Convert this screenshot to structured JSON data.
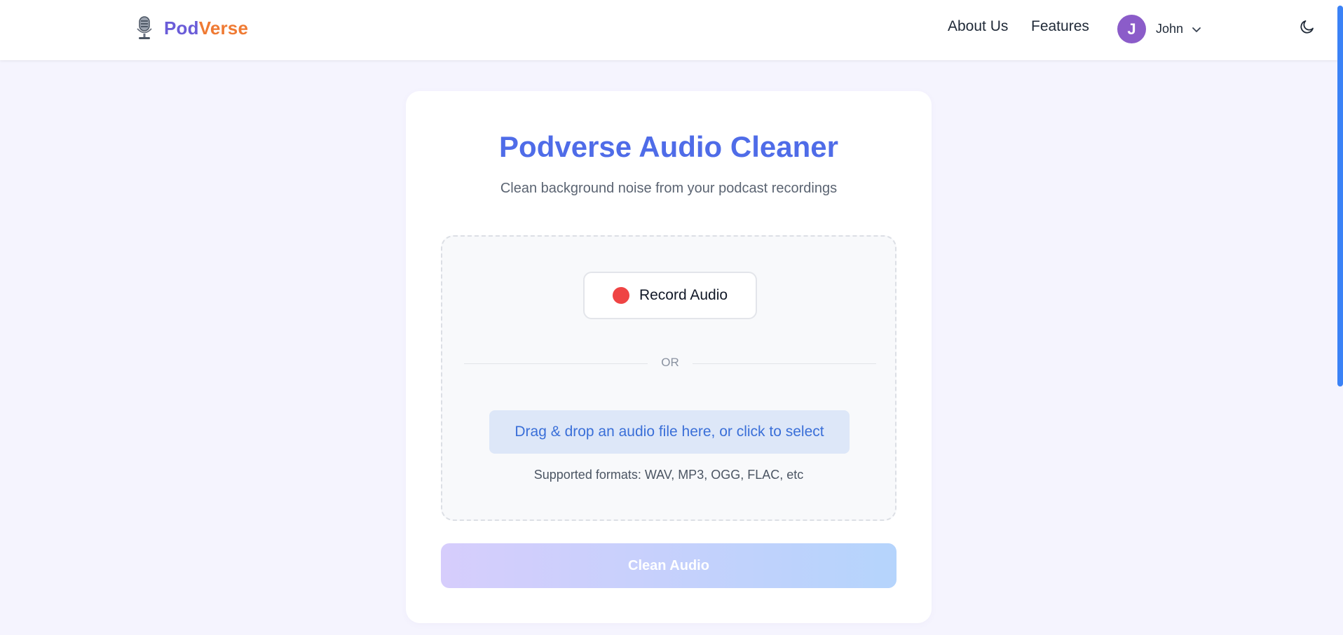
{
  "header": {
    "brand_part1": "Pod",
    "brand_part2": "Verse",
    "nav": {
      "about_label": "About Us",
      "features_label": "Features"
    },
    "user": {
      "initial": "J",
      "name": "John"
    },
    "icons": {
      "logo": "microphone-icon",
      "user_menu": "chevron-down-icon",
      "theme": "moon-icon"
    }
  },
  "main": {
    "title": "Podverse Audio Cleaner",
    "subtitle": "Clean background noise from your podcast recordings",
    "record_label": "Record Audio",
    "divider_text": "OR",
    "upload_label": "Drag & drop an audio file here, or click to select",
    "formats_text": "Supported formats: WAV, MP3, OGG, FLAC, etc",
    "clean_label": "Clean Audio"
  },
  "colors": {
    "accent": "#4f6ce8",
    "brand_primary": "#6a5cd8",
    "brand_secondary": "#ef7a33",
    "record_dot": "#ef4444",
    "avatar": "#8b5cc9",
    "page_background": "#f5f4fe"
  }
}
